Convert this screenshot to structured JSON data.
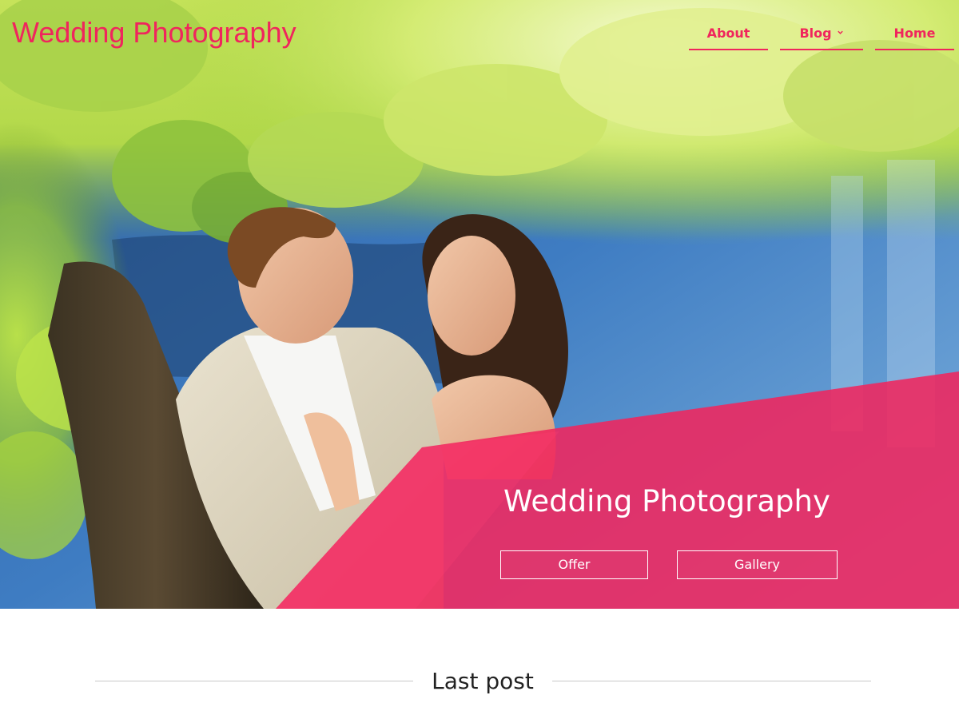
{
  "header": {
    "site_title": "Wedding Photography",
    "nav": [
      {
        "label": "About"
      },
      {
        "label": "Blog",
        "has_dropdown": true
      },
      {
        "label": "Home"
      }
    ]
  },
  "hero": {
    "heading": "Wedding Photography",
    "buttons": [
      {
        "label": "Offer"
      },
      {
        "label": "Gallery"
      }
    ],
    "accent_color": "#f0255d",
    "image_description": "couple-under-tree-by-lake"
  },
  "last_post": {
    "title": "Last post"
  },
  "icons": {
    "blog_dropdown": "chevron-down-icon"
  }
}
